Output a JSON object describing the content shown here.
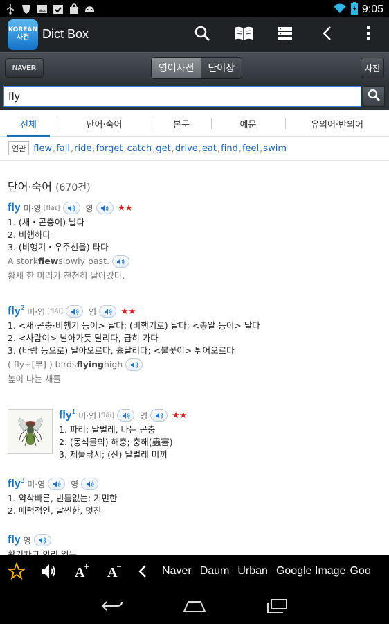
{
  "status_bar": {
    "time": "9:05",
    "left_icons": [
      "usb-icon",
      "wifi-debug-icon",
      "image-icon",
      "calendar-check-icon",
      "bag-icon",
      "android-icon"
    ],
    "right_icons": [
      "wifi-icon",
      "battery-icon"
    ]
  },
  "action_bar": {
    "app_icon_line1": "KOREAN",
    "app_icon_line2": "사전",
    "title": "Dict Box",
    "buttons": [
      "search-icon",
      "book-icon",
      "list-icon",
      "back-icon",
      "overflow-icon"
    ]
  },
  "toolbar": {
    "naver_label": "NAVER",
    "segments": [
      {
        "label": "영어사전",
        "active": true
      },
      {
        "label": "단어장",
        "active": false
      }
    ],
    "dict_label": "사전"
  },
  "search": {
    "value": "fly"
  },
  "tabs": [
    {
      "label": "전체",
      "active": true
    },
    {
      "label": "단어·숙어",
      "active": false
    },
    {
      "label": "본문",
      "active": false
    },
    {
      "label": "예문",
      "active": false
    },
    {
      "label": "유의어·반의어",
      "active": false
    }
  ],
  "related": {
    "label": "연관",
    "words": [
      "flew",
      "fall",
      "ride",
      "forget",
      "catch",
      "get",
      "drive",
      "eat",
      "find",
      "feel",
      "swim"
    ]
  },
  "section": {
    "title": "단어·숙어",
    "count": "(670건)"
  },
  "entries": [
    {
      "word": "fly",
      "sup": "",
      "pron_label": "미·영",
      "phonetic": "[flaɪ]",
      "pron_label2": "영",
      "stars": "★★",
      "defs": [
        "1. (새・곤충이) 날다",
        "2. 비행하다",
        "3. (비행기・우주선을) 타다"
      ],
      "example_en_pre": "A stork ",
      "example_en_bold": "flew",
      "example_en_post": " slowly past.",
      "example_ko": "황새 한 마리가 천천히 날아갔다."
    },
    {
      "word": "fly",
      "sup": "2",
      "pron_label": "미·영",
      "phonetic": "[flái]",
      "pron_label2": "영",
      "stars": "★★",
      "defs": [
        "1. <새·곤충·비행기 등이> 날다; (비행기로) 날다; <총알 등이> 날다",
        "2. <사람이> 날아가듯 달리다, 급히 가다",
        "3. (바람 등으로) 날아오르다, 휼날리다; <불꽃이> 튀어오르다"
      ],
      "example_en_pre": "( fly+[부] ) birds ",
      "example_en_bold": "flying",
      "example_en_post": " high",
      "example_ko": "높이 나는 새들"
    },
    {
      "word": "fly",
      "sup": "1",
      "pron_label": "미·영",
      "phonetic": "[flái]",
      "pron_label2": "영",
      "stars": "★★",
      "defs": [
        "1. 파리; 날벌레, 나는 곤충",
        "2. (동식물의) 해충; 충해(蟲害)",
        "3. 제물낚시; (산) 날벌레 미끼"
      ]
    },
    {
      "word": "fly",
      "sup": "3",
      "pron_label": "미·영",
      "pron_label2": "영",
      "defs": [
        "1. 약삭빠른, 빈틈없는; 기민한",
        "2. 매력적인, 날씬한, 멋진"
      ]
    },
    {
      "word": "fly",
      "pron_label": "영",
      "partial_def": "활기차고 의리 있는"
    }
  ],
  "bottom_bar": {
    "icons": [
      "star-icon",
      "speaker-icon",
      "font-increase-icon",
      "font-decrease-icon",
      "chevron-left-icon"
    ],
    "links": [
      "Naver",
      "Daum",
      "Urban",
      "Google Image",
      "Goo"
    ]
  },
  "nav_bar": {
    "buttons": [
      "back-nav-icon",
      "home-nav-icon",
      "recent-apps-icon"
    ]
  }
}
